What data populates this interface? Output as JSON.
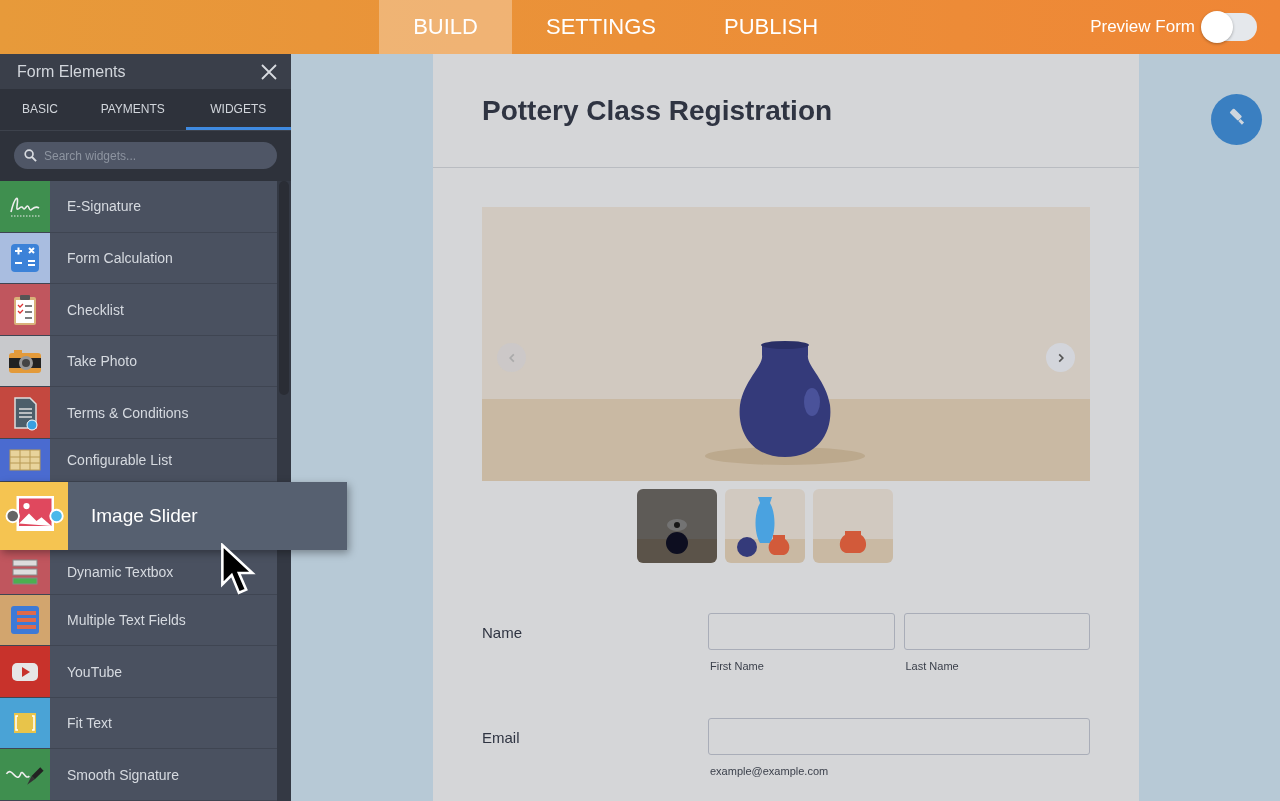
{
  "top_tabs": [
    {
      "label": "BUILD",
      "selected": true
    },
    {
      "label": "SETTINGS",
      "selected": false
    },
    {
      "label": "PUBLISH",
      "selected": false
    }
  ],
  "preview_toggle": {
    "label": "Preview Form",
    "on": false
  },
  "sidebar": {
    "title": "Form Elements",
    "tabs": [
      {
        "label": "BASIC",
        "selected": false
      },
      {
        "label": "PAYMENTS",
        "selected": false
      },
      {
        "label": "WIDGETS",
        "selected": true
      }
    ],
    "search": {
      "placeholder": "Search widgets..."
    },
    "items": [
      {
        "label": "E-Signature",
        "color": "#3f8f4f",
        "dragging": false
      },
      {
        "label": "Form Calculation",
        "color": "#a9bde0",
        "dragging": false
      },
      {
        "label": "Checklist",
        "color": "#c0565e",
        "dragging": false
      },
      {
        "label": "Take Photo",
        "color": "#c8c9cc",
        "dragging": false
      },
      {
        "label": "Terms & Conditions",
        "color": "#c4483f",
        "dragging": false
      },
      {
        "label": "Configurable List",
        "color": "#4a6bd0",
        "dragging": false
      },
      {
        "label": "Image Slider",
        "color": "#f5c451",
        "dragging": true
      },
      {
        "label": "Dynamic Textbox",
        "color": "#c0565e",
        "dragging": false
      },
      {
        "label": "Multiple Text Fields",
        "color": "#d2a56e",
        "dragging": false
      },
      {
        "label": "YouTube",
        "color": "#c8322b",
        "dragging": false
      },
      {
        "label": "Fit Text",
        "color": "#4aa3d6",
        "dragging": false
      },
      {
        "label": "Smooth Signature",
        "color": "#3f8f4f",
        "dragging": false
      }
    ]
  },
  "form": {
    "title": "Pottery Class Registration",
    "thumbnails": [
      {
        "selected": true
      },
      {
        "selected": false
      },
      {
        "selected": false
      }
    ],
    "fields": [
      {
        "label": "Name",
        "inputs": [
          "First Name",
          "Last Name"
        ]
      },
      {
        "label": "Email",
        "inputs": [
          "example@example.com"
        ]
      }
    ]
  }
}
